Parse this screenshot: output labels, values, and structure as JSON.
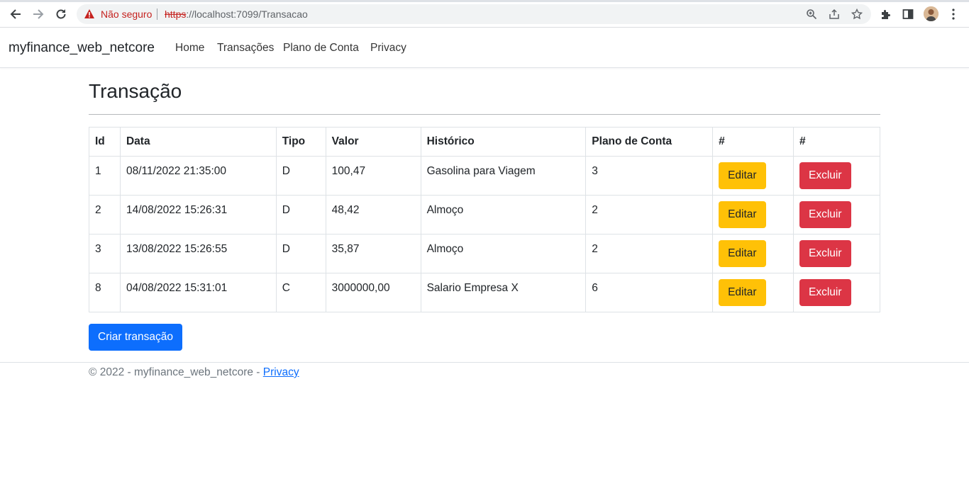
{
  "browser": {
    "insecure_label": "Não seguro",
    "url_scheme": "https",
    "url_rest": "://localhost:7099/Transacao"
  },
  "navbar": {
    "brand": "myfinance_web_netcore",
    "links": [
      "Home",
      "Transações",
      "Plano de Conta",
      "Privacy"
    ]
  },
  "page": {
    "title": "Transação"
  },
  "table": {
    "headers": [
      "Id",
      "Data",
      "Tipo",
      "Valor",
      "Histórico",
      "Plano de Conta",
      "#",
      "#"
    ],
    "rows": [
      {
        "id": "1",
        "data": "08/11/2022 21:35:00",
        "tipo": "D",
        "valor": "100,47",
        "historico": "Gasolina para Viagem",
        "plano": "3"
      },
      {
        "id": "2",
        "data": "14/08/2022 15:26:31",
        "tipo": "D",
        "valor": "48,42",
        "historico": "Almoço",
        "plano": "2"
      },
      {
        "id": "3",
        "data": "13/08/2022 15:26:55",
        "tipo": "D",
        "valor": "35,87",
        "historico": "Almoço",
        "plano": "2"
      },
      {
        "id": "8",
        "data": "04/08/2022 15:31:01",
        "tipo": "C",
        "valor": "3000000,00",
        "historico": "Salario Empresa X",
        "plano": "6"
      }
    ],
    "edit_label": "Editar",
    "delete_label": "Excluir"
  },
  "create_button": "Criar transação",
  "footer": {
    "text": "© 2022 - myfinance_web_netcore - ",
    "link": "Privacy"
  },
  "colors": {
    "primary": "#0d6efd",
    "warning": "#ffc107",
    "danger": "#dc3545"
  }
}
